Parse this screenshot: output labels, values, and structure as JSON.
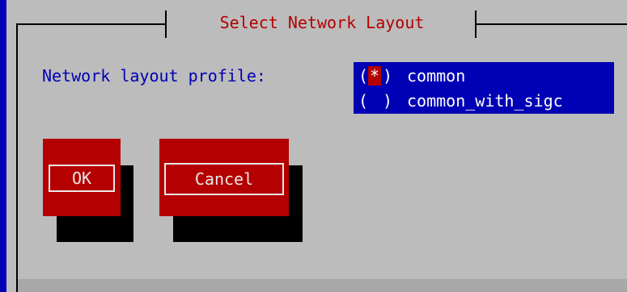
{
  "dialog": {
    "title": "Select Network Layout",
    "field_label": "Network layout profile:",
    "options": [
      {
        "label": "common",
        "selected": true,
        "mark": "*"
      },
      {
        "label": "common_with_sigc",
        "selected": false,
        "mark": " "
      }
    ],
    "buttons": {
      "ok": "OK",
      "cancel": "Cancel"
    }
  },
  "colors": {
    "screen_background": "#0000b4",
    "dialog_background": "#bcbcbc",
    "title_text": "#b40000",
    "label_text": "#0000b4",
    "list_background": "#0000b4",
    "selection_mark": "#b40000",
    "button_face": "#b40000",
    "button_text": "#e8e8e8"
  },
  "icons": {
    "radio_selected": "radio-checked-icon",
    "radio_unselected": "radio-unchecked-icon"
  }
}
